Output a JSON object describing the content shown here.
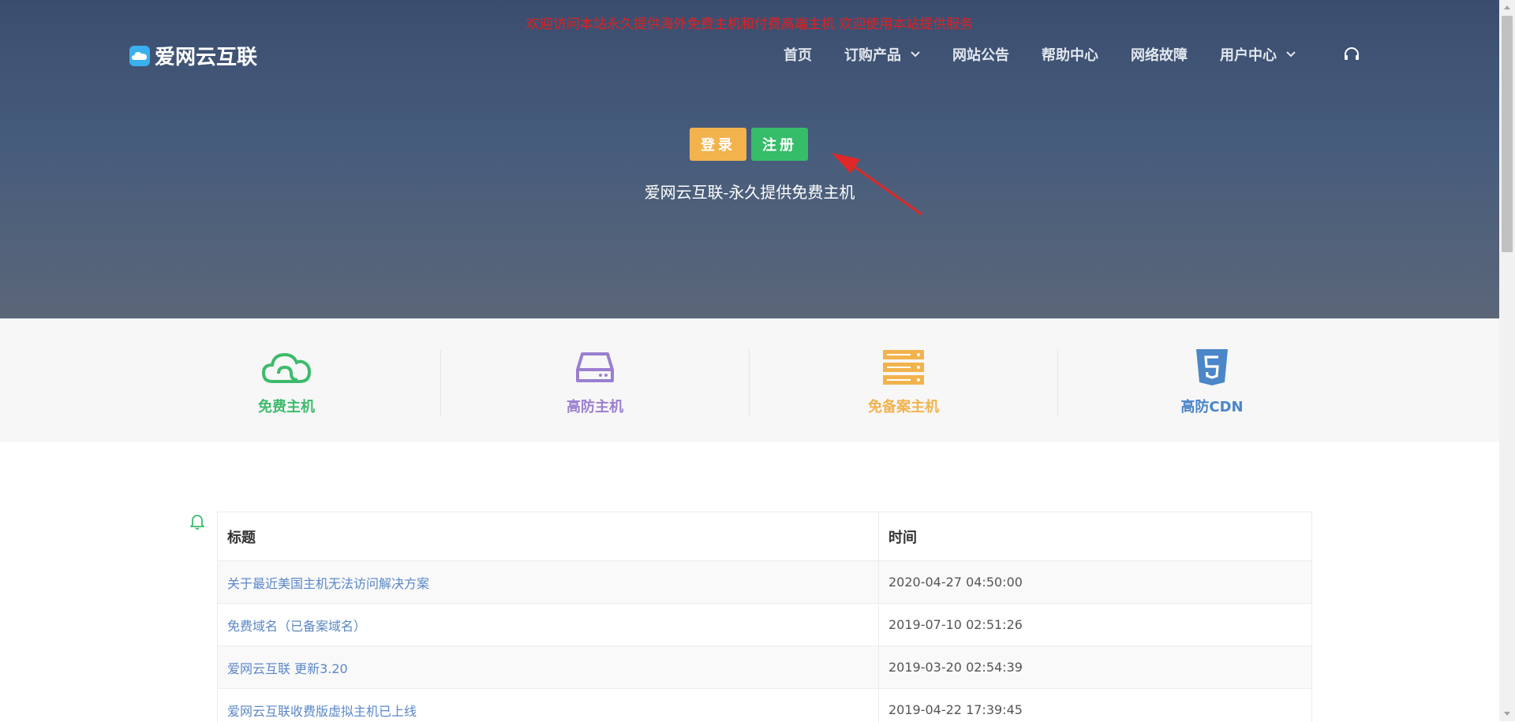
{
  "site": {
    "brand": "爱网云互联",
    "notice": "欢迎访问本站永久提供海外免费主机和付费高端主机 欢迎使用本站提供服务"
  },
  "nav": {
    "items": [
      {
        "label": "首页",
        "dropdown": false
      },
      {
        "label": "订购产品",
        "dropdown": true
      },
      {
        "label": "网站公告",
        "dropdown": false
      },
      {
        "label": "帮助中心",
        "dropdown": false
      },
      {
        "label": "网络故障",
        "dropdown": false
      },
      {
        "label": "用户中心",
        "dropdown": true
      }
    ],
    "support_icon": "headset-icon"
  },
  "hero": {
    "login_label": "登录",
    "register_label": "注册",
    "tagline": "爱网云互联-永久提供免费主机"
  },
  "features": [
    {
      "label": "免费主机",
      "icon": "cloud-icon",
      "color": "#3dbb6b"
    },
    {
      "label": "高防主机",
      "icon": "hard-drive-icon",
      "color": "#9b7fd0"
    },
    {
      "label": "免备案主机",
      "icon": "server-icon",
      "color": "#f2b34d"
    },
    {
      "label": "高防CDN",
      "icon": "html5-icon",
      "color": "#4a86c8"
    }
  ],
  "announcements": {
    "icon": "bell-icon",
    "headers": {
      "title": "标题",
      "time": "时间"
    },
    "rows": [
      {
        "title": "关于最近美国主机无法访问解决方案",
        "time": "2020-04-27 04:50:00"
      },
      {
        "title": "免费域名（已备案域名）",
        "time": "2019-07-10 02:51:26"
      },
      {
        "title": "爱网云互联 更新3.20",
        "time": "2019-03-20 02:54:39"
      },
      {
        "title": "爱网云互联收费版虚拟主机已上线",
        "time": "2019-04-22 17:39:45"
      }
    ]
  },
  "colors": {
    "login": "#f2b34d",
    "register": "#36bd69",
    "link": "#5b87c7",
    "notice": "#e02020"
  }
}
